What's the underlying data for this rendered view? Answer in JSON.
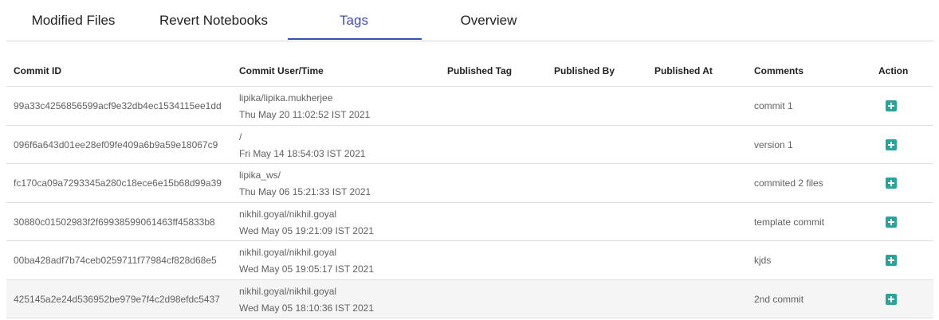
{
  "tabs": [
    {
      "label": "Modified Files"
    },
    {
      "label": "Revert Notebooks"
    },
    {
      "label": "Tags"
    },
    {
      "label": "Overview"
    }
  ],
  "active_tab": "Tags",
  "accent_color": "#3d4db7",
  "action_icon": "add-box-icon",
  "table": {
    "columns": [
      "Commit ID",
      "Commit User/Time",
      "Published Tag",
      "Published By",
      "Published At",
      "Comments",
      "Action"
    ],
    "rows": [
      {
        "commit_id": "99a33c4256856599acf9e32db4ec1534115ee1dd",
        "user": "lipika/lipika.mukherjee",
        "time": "Thu May 20 11:02:52 IST 2021",
        "published_tag": "",
        "published_by": "",
        "published_at": "",
        "comment": "commit 1"
      },
      {
        "commit_id": "096f6a643d01ee28ef09fe409a6b9a59e18067c9",
        "user": "/",
        "time": "Fri May 14 18:54:03 IST 2021",
        "published_tag": "",
        "published_by": "",
        "published_at": "",
        "comment": "version 1"
      },
      {
        "commit_id": "fc170ca09a7293345a280c18ece6e15b68d99a39",
        "user": "lipika_ws/",
        "time": "Thu May 06 15:21:33 IST 2021",
        "published_tag": "",
        "published_by": "",
        "published_at": "",
        "comment": "commited 2 files"
      },
      {
        "commit_id": "30880c01502983f2f69938599061463ff45833b8",
        "user": "nikhil.goyal/nikhil.goyal",
        "time": "Wed May 05 19:21:09 IST 2021",
        "published_tag": "",
        "published_by": "",
        "published_at": "",
        "comment": "template commit"
      },
      {
        "commit_id": "00ba428adf7b74ceb0259711f77984cf828d68e5",
        "user": "nikhil.goyal/nikhil.goyal",
        "time": "Wed May 05 19:05:17 IST 2021",
        "published_tag": "",
        "published_by": "",
        "published_at": "",
        "comment": "kjds"
      },
      {
        "commit_id": "425145a2e24d536952be979e7f4c2d98efdc5437",
        "user": "nikhil.goyal/nikhil.goyal",
        "time": "Wed May 05 18:10:36 IST 2021",
        "published_tag": "",
        "published_by": "",
        "published_at": "",
        "comment": "2nd commit"
      }
    ]
  }
}
